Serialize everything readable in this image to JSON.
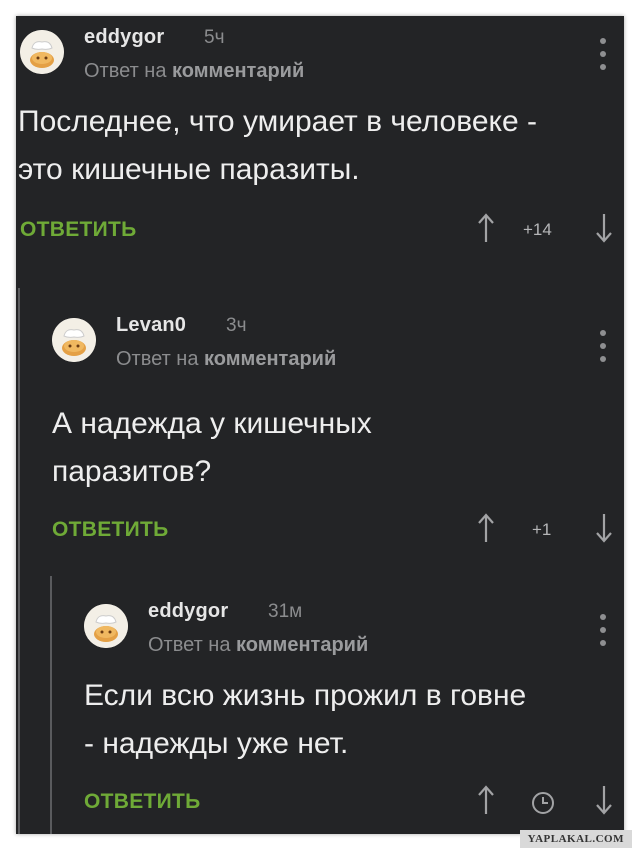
{
  "comments": [
    {
      "username": "eddygor",
      "time": "5ч",
      "reply_prefix": "Ответ на",
      "reply_target": "комментарий",
      "text_line1": "Последнее, что умирает в человеке -",
      "text_line2": "это кишечные паразиты.",
      "reply_label": "ОТВЕТИТЬ",
      "score": "+14"
    },
    {
      "username": "Levan0",
      "time": "3ч",
      "reply_prefix": "Ответ на",
      "reply_target": "комментарий",
      "text_line1": "А надежда у кишечных",
      "text_line2": "паразитов?",
      "reply_label": "ОТВЕТИТЬ",
      "score": "+1"
    },
    {
      "username": "eddygor",
      "time": "31м",
      "reply_prefix": "Ответ на",
      "reply_target": "комментарий",
      "text_line1": "Если всю жизнь прожил в говне",
      "text_line2": "- надежды уже нет.",
      "reply_label": "ОТВЕТИТЬ",
      "score_icon": "clock-icon"
    }
  ],
  "watermark": "YAPLAKAL.COM",
  "colors": {
    "background": "#232426",
    "accent": "#6faa37",
    "text": "#eeeeee",
    "muted": "#8b8c8e"
  }
}
